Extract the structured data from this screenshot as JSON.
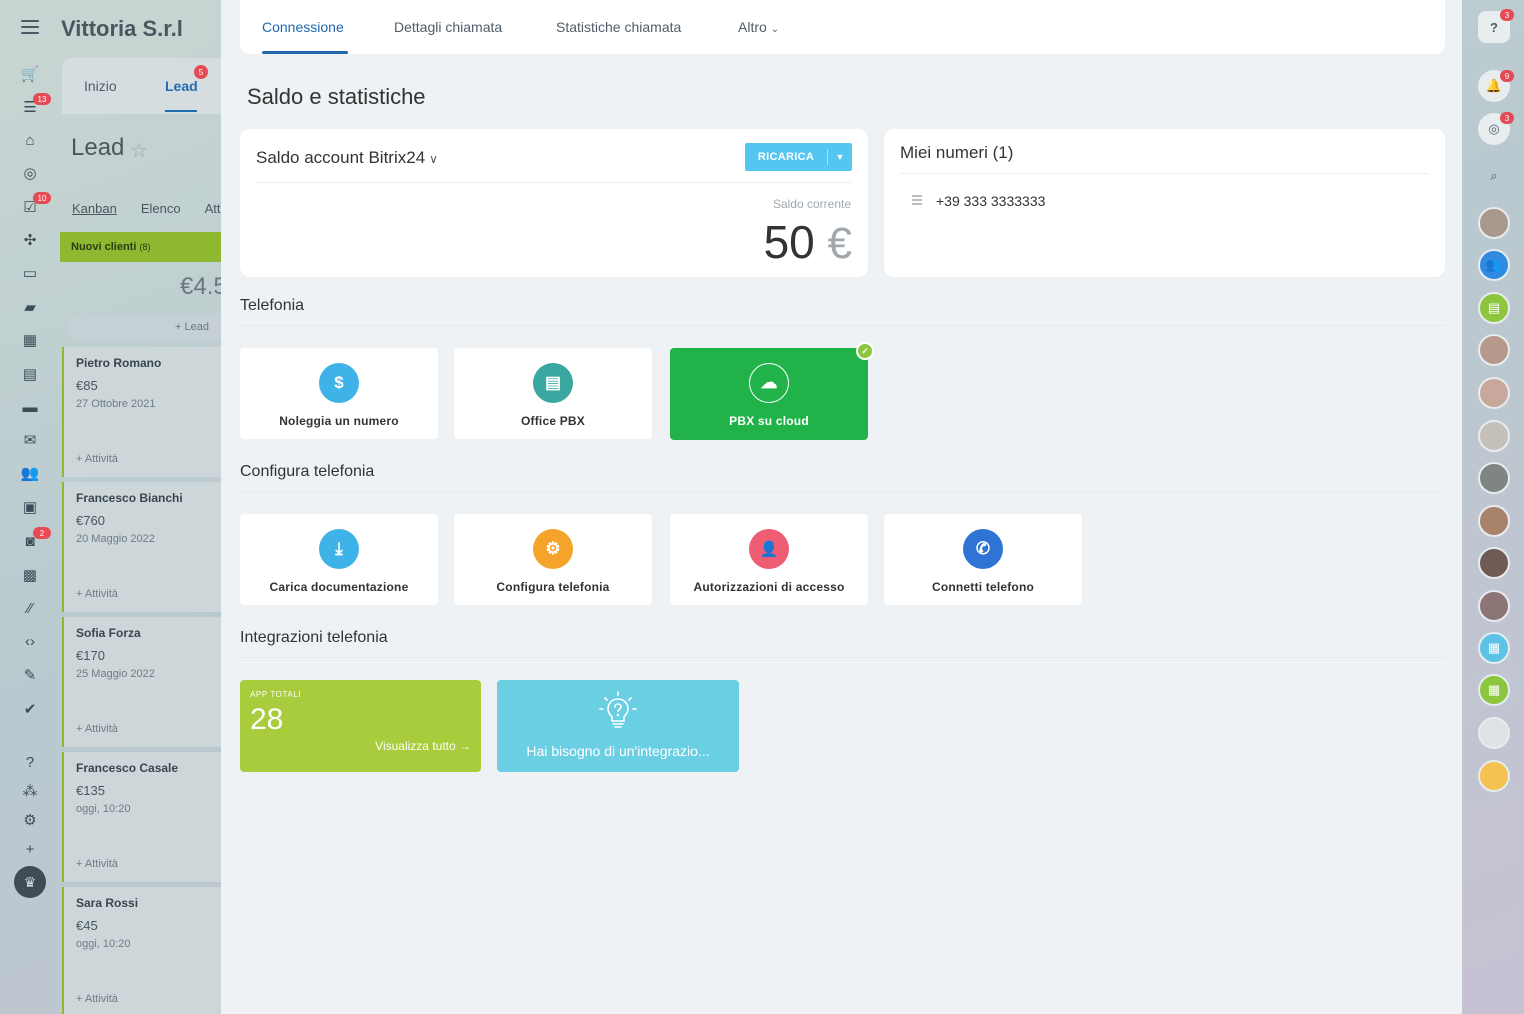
{
  "background": {
    "company_name": "Vittoria S.r.l",
    "tabs": {
      "home": "Inizio",
      "lead": "Lead",
      "lead_badge": "5"
    },
    "title": "Lead",
    "views": [
      "Kanban",
      "Elenco",
      "Att"
    ],
    "stage": {
      "name": "Nuovi clienti",
      "count": "(8)",
      "sum": "€4.5",
      "add_label": "+ Lead"
    },
    "left_rail_badges": {
      "filter": "13",
      "tasks": "10",
      "robots": "2"
    },
    "deals": [
      {
        "name": "Pietro Romano",
        "amount": "€85",
        "date": "27 Ottobre 2021",
        "activity": "+ Attività"
      },
      {
        "name": "Francesco Bianchi",
        "amount": "€760",
        "date": "20 Maggio 2022",
        "activity": "+ Attività"
      },
      {
        "name": "Sofia Forza",
        "amount": "€170",
        "date": "25 Maggio 2022",
        "activity": "+ Attività"
      },
      {
        "name": "Francesco Casale",
        "amount": "€135",
        "date": "oggi, 10:20",
        "activity": "+ Attività"
      },
      {
        "name": "Sara Rossi",
        "amount": "€45",
        "date": "oggi, 10:20",
        "activity": "+ Attività"
      }
    ],
    "right_rail_badges": {
      "help": "3",
      "notifications": "9",
      "chat": "3"
    }
  },
  "panel": {
    "nav": {
      "tabs": [
        "Connessione",
        "Dettagli chiamata",
        "Statistiche chiamata",
        "Altro"
      ],
      "caret": "⌄"
    },
    "page_title": "Saldo e statistiche",
    "balance": {
      "title": "Saldo account Bitrix24",
      "chevron": "∨",
      "recharge_label": "RICARICA",
      "current_label": "Saldo corrente",
      "value": "50",
      "currency": "€"
    },
    "numbers": {
      "title": "Miei numeri (1)",
      "items": [
        "+39 333 3333333"
      ]
    },
    "sections": {
      "telephony": "Telefonia",
      "configure": "Configura telefonia",
      "integrations": "Integrazioni telefonia"
    },
    "telephony_tiles": [
      {
        "label": "Noleggia un numero",
        "icon": "phone-dollar-icon",
        "color": "#3fb2e8",
        "glyph": "$"
      },
      {
        "label": "Office PBX",
        "icon": "office-pbx-icon",
        "color": "#3aa7a0",
        "glyph": "▤"
      },
      {
        "label": "PBX su cloud",
        "icon": "cloud-pbx-icon",
        "color": "#21b34a",
        "glyph": "☁",
        "active": true
      }
    ],
    "config_tiles": [
      {
        "label": "Carica documentazione",
        "icon": "upload-document-icon",
        "color": "#3fb2e8",
        "glyph": "⤓"
      },
      {
        "label": "Configura telefonia",
        "icon": "settings-gear-icon",
        "color": "#f4a42a",
        "glyph": "⚙"
      },
      {
        "label": "Autorizzazioni di accesso",
        "icon": "access-user-icon",
        "color": "#ee5d74",
        "glyph": "👤"
      },
      {
        "label": "Connetti telefono",
        "icon": "connect-phone-icon",
        "color": "#2f74d4",
        "glyph": "✆"
      }
    ],
    "apps": {
      "label": "APP TOTALI",
      "count": "28",
      "link": "Visualizza tutto →"
    },
    "integration_request": "Hai bisogno di un'integrazio..."
  }
}
